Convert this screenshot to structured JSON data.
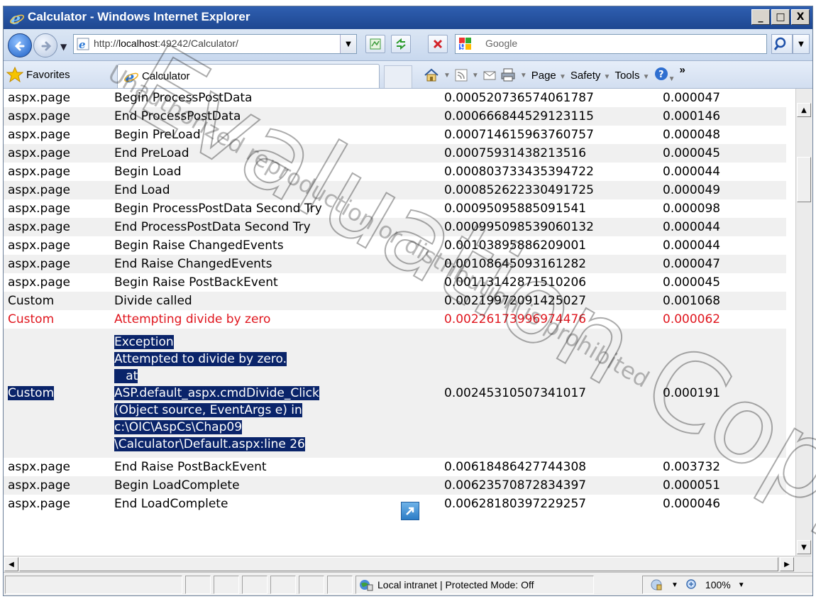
{
  "window": {
    "title": "Calculator - Windows Internet Explorer",
    "controls": {
      "minimize": "_",
      "maximize": "□",
      "close": "X"
    }
  },
  "address": {
    "url_prefix": "http://",
    "url_host": "localhost",
    "url_rest": ":49242/Calculator/",
    "search_placeholder": "Google"
  },
  "favorites": {
    "favorites_label": "Favorites",
    "tab_title": "Calculator"
  },
  "commands": {
    "page": "Page",
    "safety": "Safety",
    "tools": "Tools",
    "more": "»"
  },
  "trace_rows": [
    {
      "category": "aspx.page",
      "message": "Begin ProcessPostData",
      "from_first": "0.000520736574061787",
      "from_last": "0.000047"
    },
    {
      "category": "aspx.page",
      "message": "End ProcessPostData",
      "from_first": "0.000666844529123115",
      "from_last": "0.000146"
    },
    {
      "category": "aspx.page",
      "message": "Begin PreLoad",
      "from_first": "0.000714615963760757",
      "from_last": "0.000048"
    },
    {
      "category": "aspx.page",
      "message": "End PreLoad",
      "from_first": "0.00075931438213516",
      "from_last": "0.000045"
    },
    {
      "category": "aspx.page",
      "message": "Begin Load",
      "from_first": "0.000803733435394722",
      "from_last": "0.000044"
    },
    {
      "category": "aspx.page",
      "message": "End Load",
      "from_first": "0.000852622330491725",
      "from_last": "0.000049"
    },
    {
      "category": "aspx.page",
      "message": "Begin ProcessPostData Second Try",
      "from_first": "0.00095095885091541",
      "from_last": "0.000098"
    },
    {
      "category": "aspx.page",
      "message": "End ProcessPostData Second Try",
      "from_first": "0.000995098539060132",
      "from_last": "0.000044"
    },
    {
      "category": "aspx.page",
      "message": "Begin Raise ChangedEvents",
      "from_first": "0.00103895886209001",
      "from_last": "0.000044"
    },
    {
      "category": "aspx.page",
      "message": "End Raise ChangedEvents",
      "from_first": "0.00108645093161282",
      "from_last": "0.000047"
    },
    {
      "category": "aspx.page",
      "message": "Begin Raise PostBackEvent",
      "from_first": "0.00113142871510206",
      "from_last": "0.000045"
    },
    {
      "category": "Custom",
      "message": "Divide called",
      "from_first": "0.00219972091425027",
      "from_last": "0.001068"
    },
    {
      "category": "Custom",
      "message": "Attempting divide by zero",
      "from_first": "0.00226173996974476",
      "from_last": "0.000062"
    }
  ],
  "exception_row": {
    "category": "Custom",
    "lines": [
      "Exception",
      "Attempted to divide by zero.",
      "   at",
      "ASP.default_aspx.cmdDivide_Click",
      "(Object source, EventArgs e) in",
      "c:\\OIC\\AspCs\\Chap09",
      "\\Calculator\\Default.aspx:line 26"
    ],
    "from_first": "0.00245310507341017",
    "from_last": "0.000191"
  },
  "trace_rows_after": [
    {
      "category": "aspx.page",
      "message": "End Raise PostBackEvent",
      "from_first": "0.00618486427744308",
      "from_last": "0.003732"
    },
    {
      "category": "aspx.page",
      "message": "Begin LoadComplete",
      "from_first": "0.00623570872834397",
      "from_last": "0.000051"
    },
    {
      "category": "aspx.page",
      "message": "End LoadComplete",
      "from_first": "0.00628180397229257",
      "from_last": "0.000046"
    }
  ],
  "status": {
    "zone": "Local intranet | Protected Mode: Off",
    "zoom": "100%"
  },
  "watermark": {
    "large": "Evaluation Copy",
    "small": "Unauthorized reproduction or distribution is prohibited"
  },
  "colors": {
    "title_bar": "#1e4791",
    "warning_text": "#e0161e",
    "selection": "#0a246a",
    "alt_row": "#f0f0f0"
  }
}
